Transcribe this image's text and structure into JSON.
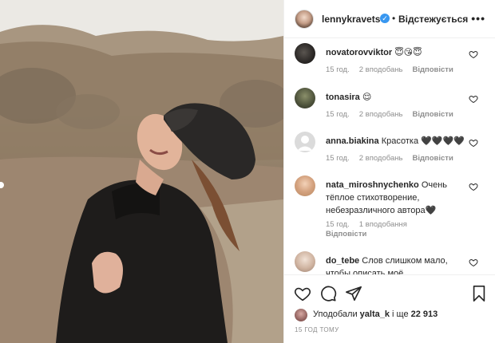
{
  "post": {
    "username": "lennykravets",
    "separator": "•",
    "follow_label": "Відстежується",
    "more_icon": "more-options-icon",
    "verified_icon": "verified-badge-icon",
    "verified_glyph": "✓"
  },
  "comments": [
    {
      "username": "novatorovviktor",
      "text": "😇😘😇",
      "time": "15 год.",
      "likes": "2 вподобань",
      "reply": "Відповісти",
      "replies": ""
    },
    {
      "username": "tonasira",
      "text": "😌",
      "time": "15 год.",
      "likes": "2 вподобань",
      "reply": "Відповісти",
      "replies": ""
    },
    {
      "username": "anna.biakina",
      "text": "Красотка 🖤🖤🖤🖤",
      "time": "15 год.",
      "likes": "2 вподобань",
      "reply": "Відповісти",
      "replies": ""
    },
    {
      "username": "nata_miroshnychenko",
      "text": "Очень тёплое стихотворение, небезразличного автора🖤",
      "time": "15 год.",
      "likes": "1 вподобання",
      "reply": "Відповісти",
      "replies": ""
    },
    {
      "username": "do_tebe",
      "text": "Слов слишком мало, чтобы описать моё",
      "time": "",
      "likes": "",
      "reply": "",
      "replies": ""
    }
  ],
  "actions": {
    "like_icon": "heart-icon",
    "comment_icon": "comment-icon",
    "share_icon": "share-icon",
    "save_icon": "bookmark-icon"
  },
  "likes": {
    "prefix": "Уподобали",
    "user": "yalta_k",
    "middle": "і ще",
    "count": "22 913"
  },
  "time_ago": "15 ГОД ТОМУ",
  "colors": {
    "text": "#262626",
    "secondary": "#8e8e8e",
    "verified": "#3897f0",
    "border": "#efefef"
  }
}
